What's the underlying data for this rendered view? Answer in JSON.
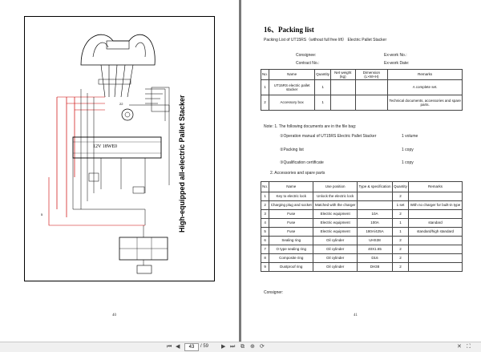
{
  "left_page": {
    "title": "High-equipped all-electric Pallet Stacker",
    "page_number": "40",
    "board_label": "12V  18WE0"
  },
  "right_page": {
    "section_title": "16、Packing list",
    "subtitle": "Packing List of UT15RS（without full free lift） Electric Pallet Stacker",
    "consignee_label": "Consignee:",
    "contract_label": "Contract No.:",
    "exwork_no_label": "Ex-work No.:",
    "exwork_date_label": "Ex-work Date:",
    "table1": {
      "headers": [
        "No.",
        "Name",
        "Quantity",
        "Net weight (kg)",
        "Dimension (L×W×H)",
        "Remarks"
      ],
      "rows": [
        [
          "1",
          "UT15RS electric pallet stacker",
          "1",
          "",
          "",
          "A complete set."
        ],
        [
          "2",
          "Accessory box",
          "1",
          "",
          "",
          "Technical documents, accessories and spare parts."
        ]
      ]
    },
    "note1": "Note: 1. The following documents are in the file bag:",
    "docs": [
      {
        "name": "①Operation manual of UT15RS  Electric Pallet Stacker",
        "qty": "1 volume"
      },
      {
        "name": "②Packing list",
        "qty": "1 copy"
      },
      {
        "name": "③Qualification certificate",
        "qty": "1 copy"
      }
    ],
    "note2": "2.  Accessories and spare parts",
    "table2": {
      "headers": [
        "No.",
        "Name",
        "Use position",
        "Type & specification",
        "Quantity",
        "Remarks"
      ],
      "rows": [
        [
          "1",
          "Key to electric lock",
          "Unlock the electric lock",
          "",
          "2",
          ""
        ],
        [
          "2",
          "Charging plug and socket",
          "Matched with the charger",
          "",
          "1 set",
          "With no charger for built-in type"
        ],
        [
          "3",
          "Fuse",
          "Electric equipment",
          "10A",
          "2",
          ""
        ],
        [
          "4",
          "Fuse",
          "Electric equipment",
          "100A",
          "1",
          "standard"
        ],
        [
          "5",
          "Fuse",
          "Electric equipment",
          "180A/425A",
          "1",
          "standard/high standard"
        ],
        [
          "6",
          "Sealing ring",
          "Oil cylinder",
          "UHS38",
          "2",
          ""
        ],
        [
          "7",
          "O type sealing ring",
          "Oil cylinder",
          "40X1.65",
          "2",
          ""
        ],
        [
          "8",
          "Composite ring",
          "Oil cylinder",
          "D16",
          "2",
          ""
        ],
        [
          "9",
          "Dustproof ring",
          "Oil cylinder",
          "DH38",
          "2",
          ""
        ]
      ]
    },
    "consigner_label": "Consigner:",
    "page_number": "41"
  },
  "toolbar": {
    "current_page": "43",
    "page_count": "/ 59"
  }
}
